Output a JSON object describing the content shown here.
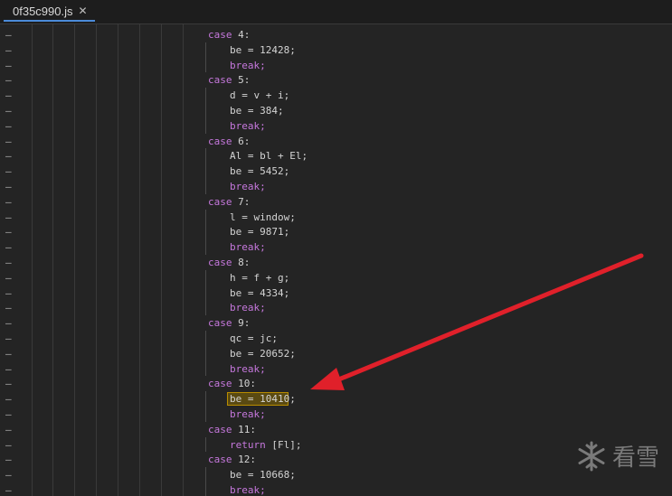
{
  "tab": {
    "filename": "0f35c990.js",
    "close_glyph": "✕"
  },
  "lines": [
    {
      "segs": [
        {
          "t": "case ",
          "k": true
        },
        {
          "t": "4:"
        }
      ],
      "indent": 0
    },
    {
      "segs": [
        {
          "t": "be = 12428;"
        }
      ],
      "indent": 1
    },
    {
      "segs": [
        {
          "t": "break;",
          "k": true
        }
      ],
      "indent": 1
    },
    {
      "segs": [
        {
          "t": "case ",
          "k": true
        },
        {
          "t": "5:"
        }
      ],
      "indent": 0
    },
    {
      "segs": [
        {
          "t": "d = v + i;"
        }
      ],
      "indent": 1
    },
    {
      "segs": [
        {
          "t": "be = 384;"
        }
      ],
      "indent": 1
    },
    {
      "segs": [
        {
          "t": "break;",
          "k": true
        }
      ],
      "indent": 1
    },
    {
      "segs": [
        {
          "t": "case ",
          "k": true
        },
        {
          "t": "6:"
        }
      ],
      "indent": 0
    },
    {
      "segs": [
        {
          "t": "Al = bl + El;"
        }
      ],
      "indent": 1
    },
    {
      "segs": [
        {
          "t": "be = 5452;"
        }
      ],
      "indent": 1
    },
    {
      "segs": [
        {
          "t": "break;",
          "k": true
        }
      ],
      "indent": 1
    },
    {
      "segs": [
        {
          "t": "case ",
          "k": true
        },
        {
          "t": "7:"
        }
      ],
      "indent": 0
    },
    {
      "segs": [
        {
          "t": "l = window;"
        }
      ],
      "indent": 1
    },
    {
      "segs": [
        {
          "t": "be = 9871;"
        }
      ],
      "indent": 1
    },
    {
      "segs": [
        {
          "t": "break;",
          "k": true
        }
      ],
      "indent": 1
    },
    {
      "segs": [
        {
          "t": "case ",
          "k": true
        },
        {
          "t": "8:"
        }
      ],
      "indent": 0
    },
    {
      "segs": [
        {
          "t": "h = f + g;"
        }
      ],
      "indent": 1
    },
    {
      "segs": [
        {
          "t": "be = 4334;"
        }
      ],
      "indent": 1
    },
    {
      "segs": [
        {
          "t": "break;",
          "k": true
        }
      ],
      "indent": 1
    },
    {
      "segs": [
        {
          "t": "case ",
          "k": true
        },
        {
          "t": "9:"
        }
      ],
      "indent": 0
    },
    {
      "segs": [
        {
          "t": "qc = jc;"
        }
      ],
      "indent": 1
    },
    {
      "segs": [
        {
          "t": "be = 20652;"
        }
      ],
      "indent": 1
    },
    {
      "segs": [
        {
          "t": "break;",
          "k": true
        }
      ],
      "indent": 1
    },
    {
      "segs": [
        {
          "t": "case ",
          "k": true
        },
        {
          "t": "10:"
        }
      ],
      "indent": 0
    },
    {
      "segs": [
        {
          "t": "be = 10410;"
        }
      ],
      "indent": 1,
      "highlight": true
    },
    {
      "segs": [
        {
          "t": "break;",
          "k": true
        }
      ],
      "indent": 1
    },
    {
      "segs": [
        {
          "t": "case ",
          "k": true
        },
        {
          "t": "11:"
        }
      ],
      "indent": 0
    },
    {
      "segs": [
        {
          "t": "return",
          "k": true
        },
        {
          "t": " [Fl];"
        }
      ],
      "indent": 1
    },
    {
      "segs": [
        {
          "t": "case ",
          "k": true
        },
        {
          "t": "12:"
        }
      ],
      "indent": 0
    },
    {
      "segs": [
        {
          "t": "be = 10668;"
        }
      ],
      "indent": 1
    },
    {
      "segs": [
        {
          "t": "break;",
          "k": true
        }
      ],
      "indent": 1
    }
  ],
  "gutter_marker": "–",
  "watermark": {
    "text": "看雪",
    "icon": "snowflake-icon"
  },
  "colors": {
    "keyword": "#c678dd",
    "text": "#d4d4d4",
    "highlight_bg": "#5a4a12",
    "arrow": "#e0202a"
  }
}
